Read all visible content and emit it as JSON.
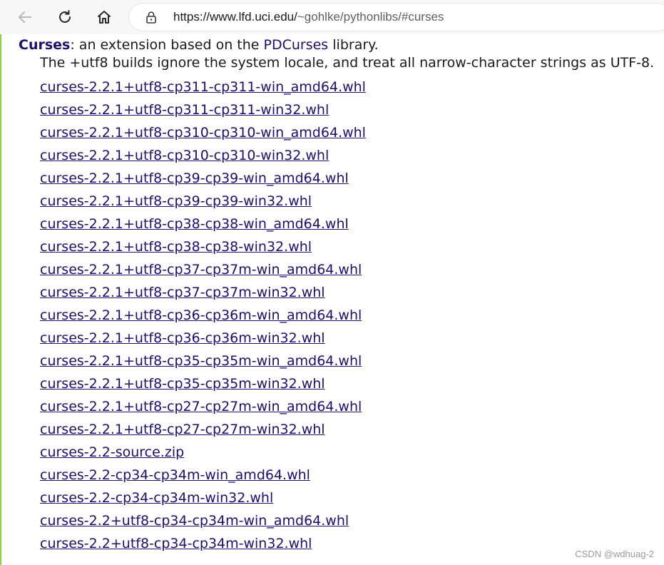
{
  "browser": {
    "url_host": "https://www.lfd.uci.edu/",
    "url_path": "~gohlke/pythonlibs/#curses",
    "icons": [
      "back-arrow-icon",
      "reload-icon",
      "home-icon",
      "lock-icon"
    ]
  },
  "page": {
    "package_name": "Curses",
    "description_prefix": ": an extension based on the ",
    "pdcurses_link": "PDCurses",
    "description_suffix": " library.",
    "note": "The +utf8 builds ignore the system locale, and treat all narrow-character strings as UTF-8.",
    "files": [
      "curses-2.2.1+utf8-cp311-cp311-win_amd64.whl",
      "curses-2.2.1+utf8-cp311-cp311-win32.whl",
      "curses-2.2.1+utf8-cp310-cp310-win_amd64.whl",
      "curses-2.2.1+utf8-cp310-cp310-win32.whl",
      "curses-2.2.1+utf8-cp39-cp39-win_amd64.whl",
      "curses-2.2.1+utf8-cp39-cp39-win32.whl",
      "curses-2.2.1+utf8-cp38-cp38-win_amd64.whl",
      "curses-2.2.1+utf8-cp38-cp38-win32.whl",
      "curses-2.2.1+utf8-cp37-cp37m-win_amd64.whl",
      "curses-2.2.1+utf8-cp37-cp37m-win32.whl",
      "curses-2.2.1+utf8-cp36-cp36m-win_amd64.whl",
      "curses-2.2.1+utf8-cp36-cp36m-win32.whl",
      "curses-2.2.1+utf8-cp35-cp35m-win_amd64.whl",
      "curses-2.2.1+utf8-cp35-cp35m-win32.whl",
      "curses-2.2.1+utf8-cp27-cp27m-win_amd64.whl",
      "curses-2.2.1+utf8-cp27-cp27m-win32.whl",
      "curses-2.2-source.zip",
      "curses-2.2-cp34-cp34m-win_amd64.whl",
      "curses-2.2-cp34-cp34m-win32.whl",
      "curses-2.2+utf8-cp34-cp34m-win_amd64.whl",
      "curses-2.2+utf8-cp34-cp34m-win32.whl"
    ]
  },
  "watermark": "CSDN @wdhuag-2",
  "colors": {
    "link": "#1d0f6e",
    "text": "#1a1a1a",
    "accent_edge": "#8fd04a"
  }
}
